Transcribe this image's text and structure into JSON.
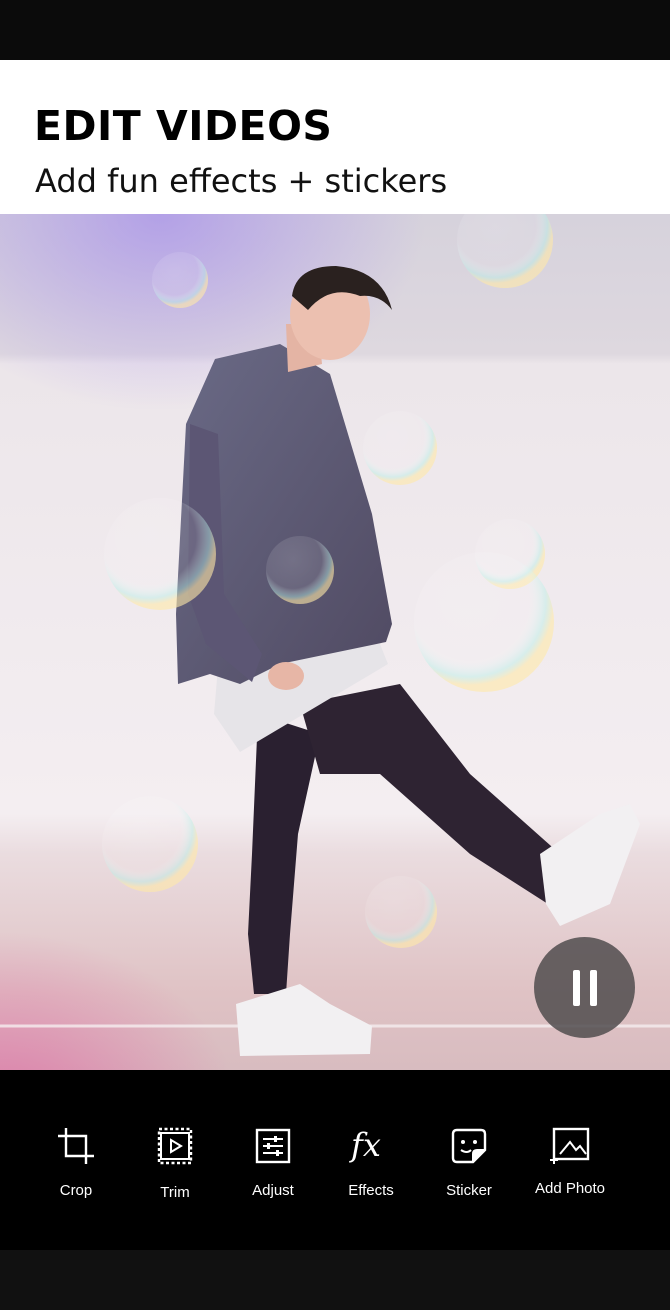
{
  "header": {
    "title": "EDIT VIDEOS",
    "subtitle": "Add fun effects + stickers"
  },
  "player": {
    "state": "playing",
    "pause_icon": "pause-icon"
  },
  "toolbar": {
    "tools": [
      {
        "label": "Crop",
        "icon": "crop-icon"
      },
      {
        "label": "Trim",
        "icon": "trim-icon"
      },
      {
        "label": "Adjust",
        "icon": "adjust-icon"
      },
      {
        "label": "Effects",
        "icon": "effects-fx-icon"
      },
      {
        "label": "Sticker",
        "icon": "sticker-icon"
      },
      {
        "label": "Add Photo",
        "icon": "add-photo-icon"
      }
    ]
  },
  "colors": {
    "header_bg": "#ffffff",
    "toolbar_bg": "#000000",
    "text_on_dark": "#ffffff"
  }
}
